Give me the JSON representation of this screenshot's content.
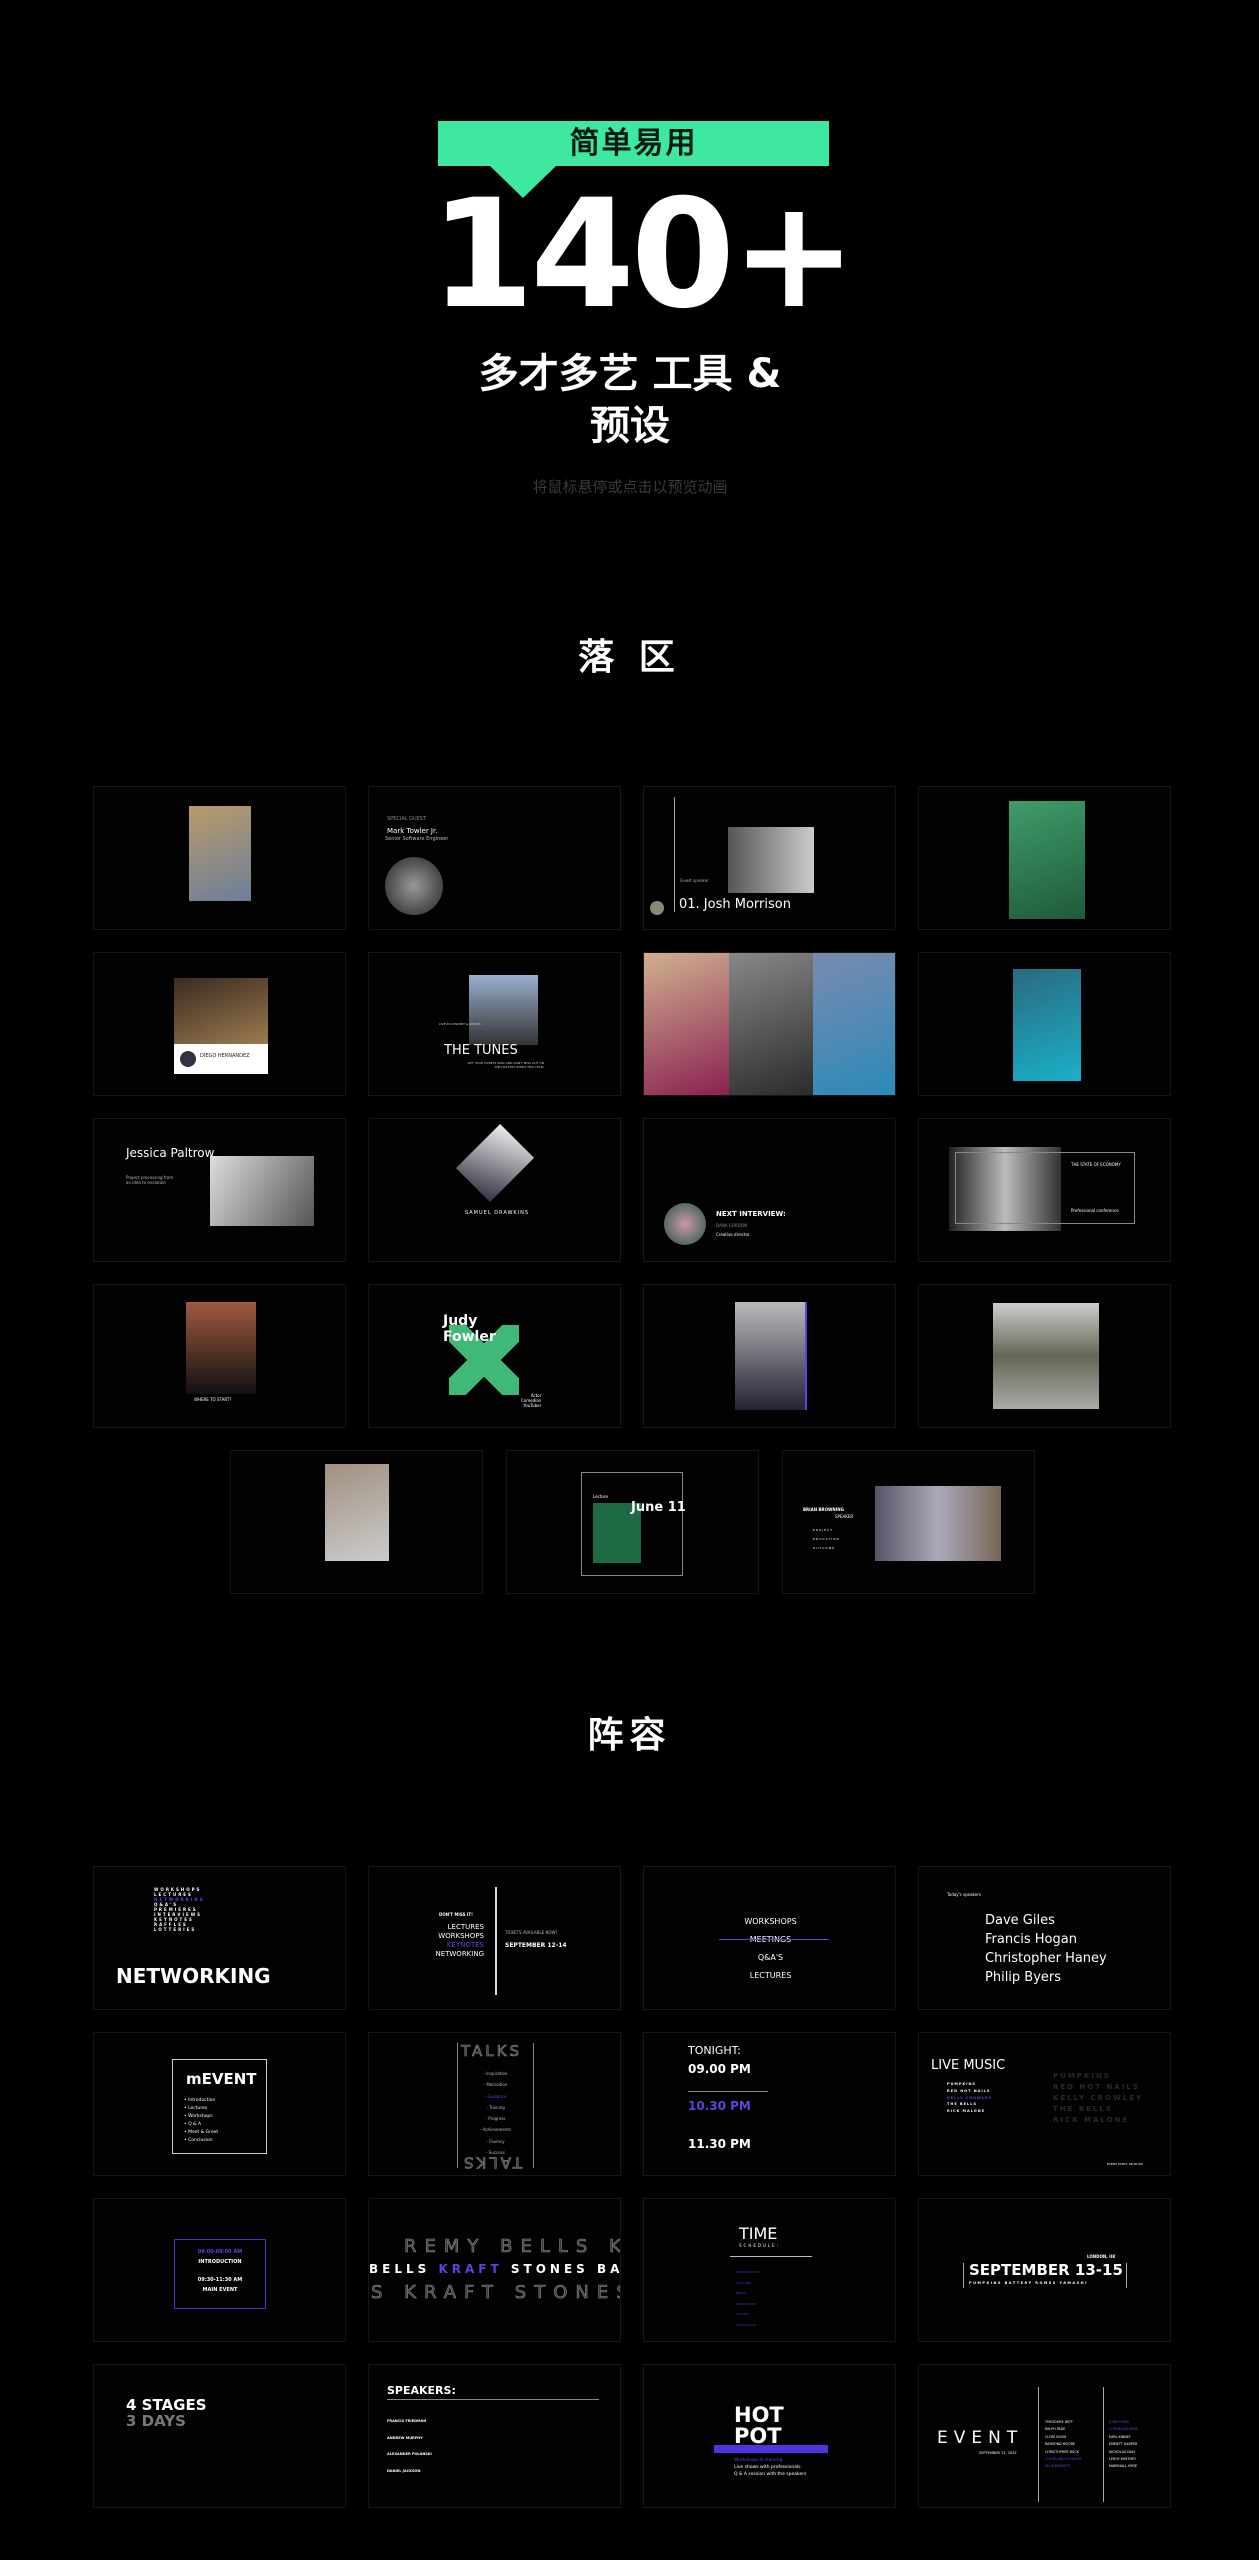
{
  "hero": {
    "badge": "简单易用",
    "count": "140+",
    "subtitle_line1": "多才多艺 工具 &",
    "subtitle_line2": "预设",
    "hint": "将鼠标悬停或点击以预览动画"
  },
  "colors": {
    "accent_green": "#3ee8a0",
    "accent_purple": "#5b45e0",
    "background": "#000000"
  },
  "section1": {
    "title": "落 区",
    "cards": {
      "c2": {
        "label": "SPECIAL GUEST",
        "name": "Mark Towler Jr.",
        "role": "Senior Software Engineer"
      },
      "c3": {
        "label": "Guest speaker",
        "name": "01. Josh Morrison"
      },
      "c5": {
        "name": "DIEGO HERNANDEZ"
      },
      "c6": {
        "tag": "LIVE IN CONCERT & SHOWS",
        "title": "THE TUNES",
        "body": "GET YOUR TICKETS NOW AND DON'T MISS OUT ON THE HOTTEST EVENT THIS YEAR!"
      },
      "c9": {
        "name": "Jessica Paltrow",
        "body": "Project processing from an idea to evolution"
      },
      "c10": {
        "name": "SAMUEL DRAWKINS"
      },
      "c11": {
        "title": "NEXT INTERVIEW:",
        "name": "DANA GORDON",
        "role": "Creative director"
      },
      "c12": {
        "title": "THE STATE OF ECONOMY",
        "sub": "Professional conference"
      },
      "c13": {
        "title": "WHERE TO START?"
      },
      "c14": {
        "name1": "Judy",
        "name2": "Fowler",
        "roles": [
          "Actor",
          "Comedian",
          "YouTuber"
        ]
      },
      "c18": {
        "label": "Lecture",
        "date": "June 11"
      },
      "c19": {
        "name": "BRIAN BROWNING",
        "role": "SPEAKER",
        "items": [
          "PROJECT",
          "EDUCATION",
          "OUTCOME"
        ]
      }
    }
  },
  "section2": {
    "title": "阵容",
    "networking": {
      "list": [
        "WORKSHOPS",
        "LECTURES",
        "NETWORKING",
        "Q&A'S",
        "PREMIERES",
        "INTERVIEWS",
        "KEYNOTES",
        "RAFFLES",
        "LOTTERIES"
      ],
      "title": "NETWORKING"
    },
    "dontmiss": {
      "label": "DON'T MISS IT!",
      "items": [
        "LECTURES",
        "WORKSHOPS",
        "KEYNOTES",
        "NETWORKING"
      ],
      "tickets": "TICKETS AVAILABLE NOW!",
      "dates": "SEPTEMBER 12-14"
    },
    "workshops": {
      "items": [
        "WORKSHOPS",
        "MEETINGS",
        "Q&A'S",
        "LECTURES"
      ]
    },
    "speakers_today": {
      "label": "Today's speakers",
      "names": [
        "Dave Giles",
        "Francis Hogan",
        "Christopher Haney",
        "Philip Byers"
      ]
    },
    "mevent": {
      "title": "mEVENT",
      "items": [
        "• Introduction",
        "• Lectures",
        "• Workshops",
        "• Q & A",
        "• Meet & Greet",
        "• Conclusion"
      ]
    },
    "talks": {
      "title": "TALKS",
      "items": [
        "- Inspiration",
        "- Motivation",
        "- Guidance",
        "- Training",
        "- Progress",
        "- Achievements",
        "- Fluency",
        "- Success"
      ]
    },
    "tonight": {
      "title": "TONIGHT:",
      "times": [
        "09.00 PM",
        "10.30 PM",
        "11.30 PM"
      ]
    },
    "live_music": {
      "title": "LIVE MUSIC",
      "acts": [
        "PUMPKINS",
        "RED HOT NAILS",
        "KELLY CROWLEY",
        "THE BELLS",
        "RICK MALONE"
      ],
      "start": "EVENT START: 08:00 PM"
    },
    "schedule_box": {
      "time1": "08:00-09:00 AM",
      "event1": "INTRODUCTION",
      "time2": "09:30-11:30 AM",
      "event2": "MAIN EVENT"
    },
    "marquee": {
      "line1": "REMY BELLS K",
      "line2a": "BELLS ",
      "line2b": "KRAFT",
      "line2c": " STONES BAT",
      "line3": "S KRAFT STONES"
    },
    "time_schedule": {
      "title": "TIME",
      "sub": "SCHEDULE:",
      "items": [
        "INTRODUCTION",
        "LECTURES",
        "BREAK",
        "WORKSHOPS",
        "LOTTERY",
        "CONCLUSION"
      ]
    },
    "september": {
      "location": "LONDON, UK",
      "dates": "SEPTEMBER 13-15",
      "acts": "PUMPKINS BATTERY ROMES YAMASHI"
    },
    "stages": {
      "line1": "4 STAGES",
      "line2": "3 DAYS"
    },
    "speakers": {
      "title": "SPEAKERS:",
      "names": [
        "FRANCIS FRIEDMAN",
        "ANDREW MURPHY",
        "ALEXANDER POLANSKI",
        "DANIEL JACKSON"
      ]
    },
    "hotpot": {
      "line1": "HOT",
      "line2": "POT",
      "items": [
        "Workshops & training",
        "Live shows with professionals",
        "Q & A session with the speakers"
      ]
    },
    "event": {
      "title": "EVENT",
      "date": "SEPTEMBER 13, 2022",
      "col1": [
        "THEODORE WITT",
        "RALPH PAGE",
        "CLYDE KLEIN",
        "RAYMOND MOORE",
        "CHRISTOPHER BUCK",
        "CLEVELAND SCHAFER",
        "ELLIS BARRETT"
      ],
      "col2": [
        "JOHN FLYNN",
        "CORNELIUS KERR",
        "EARL KINNEY",
        "EMMETT HARPER",
        "NICHOLAS DALY",
        "LEROY WHITNEY",
        "MARSHALL HYDE"
      ]
    }
  }
}
